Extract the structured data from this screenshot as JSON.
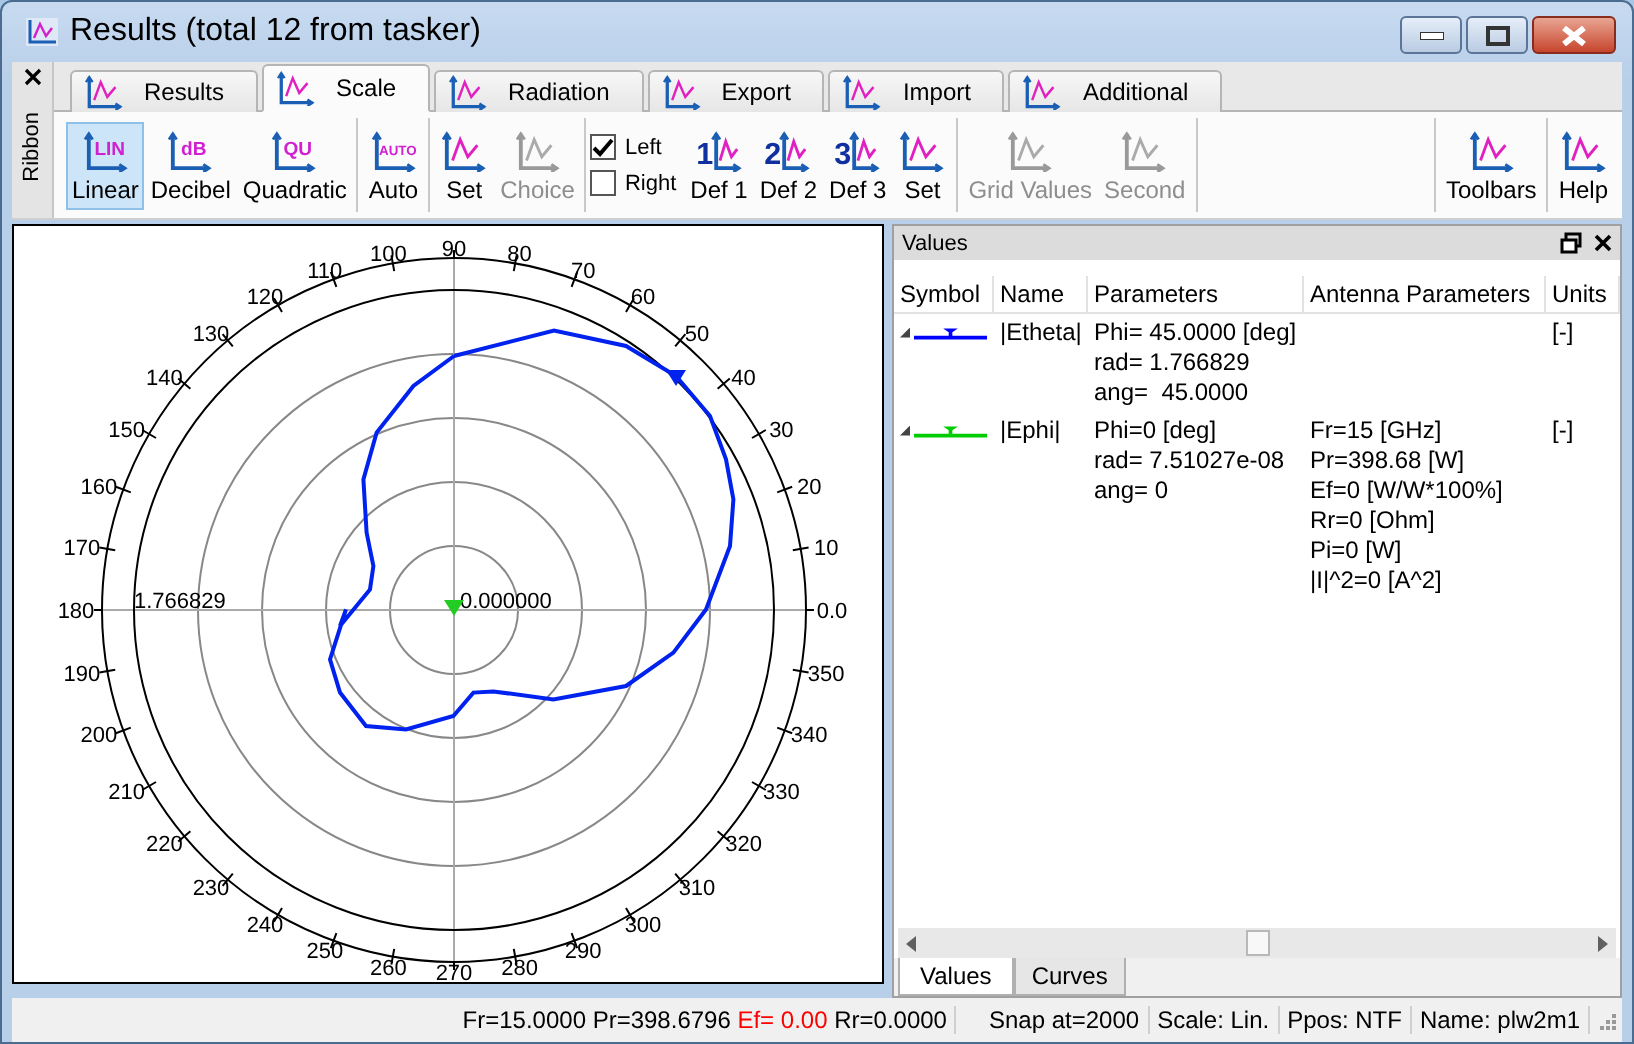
{
  "window": {
    "title": "Results (total 12 from tasker)"
  },
  "ribbon": {
    "label": "Ribbon"
  },
  "tabs": [
    {
      "label": "Results",
      "selected": false
    },
    {
      "label": "Scale",
      "selected": true
    },
    {
      "label": "Radiation",
      "selected": false
    },
    {
      "label": "Export",
      "selected": false
    },
    {
      "label": "Import",
      "selected": false
    },
    {
      "label": "Additional",
      "selected": false
    }
  ],
  "toolbar": {
    "groups": [
      [
        {
          "kind": "button",
          "label": "Linear",
          "badge": "LIN",
          "selected": true,
          "disabled": false
        },
        {
          "kind": "button",
          "label": "Decibel",
          "badge": "dB",
          "selected": false,
          "disabled": false
        },
        {
          "kind": "button",
          "label": "Quadratic",
          "badge": "QU",
          "selected": false,
          "disabled": false
        }
      ],
      [
        {
          "kind": "button",
          "label": "Auto",
          "badge": "AUTO",
          "selected": false,
          "disabled": false
        }
      ],
      [
        {
          "kind": "button",
          "label": "Set",
          "selected": false,
          "disabled": false
        },
        {
          "kind": "button",
          "label": "Choice",
          "selected": false,
          "disabled": true
        }
      ],
      [
        {
          "kind": "checkbox",
          "label": "Left",
          "checked": true
        },
        {
          "kind": "checkbox",
          "label": "Right",
          "checked": false
        },
        {
          "kind": "button",
          "label": "Def 1",
          "badge": "1",
          "selected": false,
          "disabled": false
        },
        {
          "kind": "button",
          "label": "Def 2",
          "badge": "2",
          "selected": false,
          "disabled": false
        },
        {
          "kind": "button",
          "label": "Def 3",
          "badge": "3",
          "selected": false,
          "disabled": false
        },
        {
          "kind": "button",
          "label": "Set",
          "selected": false,
          "disabled": false
        }
      ],
      [
        {
          "kind": "button",
          "label": "Grid Values",
          "selected": false,
          "disabled": true
        },
        {
          "kind": "button",
          "label": "Second",
          "selected": false,
          "disabled": true
        }
      ]
    ],
    "right_groups": [
      [
        {
          "kind": "button",
          "label": "Toolbars",
          "selected": false,
          "disabled": false
        }
      ],
      [
        {
          "kind": "button",
          "label": "Help",
          "selected": false,
          "disabled": false
        }
      ]
    ]
  },
  "polar_plot": {
    "left_angle_labels": [
      "100",
      "110",
      "120",
      "130",
      "140",
      "150",
      "160",
      "170",
      "180",
      "190",
      "200",
      "210",
      "220",
      "230",
      "240",
      "250",
      "260"
    ],
    "right_angle_labels": [
      "90",
      "80",
      "70",
      "60",
      "50",
      "40",
      "30",
      "20",
      "10",
      "0.0",
      "350",
      "340",
      "330",
      "320",
      "310",
      "300",
      "290",
      "280",
      "270"
    ],
    "radius_label": "1.766829",
    "center_label": "0.000000"
  },
  "values_panel": {
    "title": "Values",
    "columns": [
      "Symbol",
      "Name",
      "Parameters",
      "Antenna Parameters",
      "Units"
    ],
    "rows": [
      {
        "expanded": true,
        "color": "#0000ff",
        "name": "|Etheta|",
        "parameters": [
          "Phi= 45.0000 [deg]",
          "rad= 1.766829",
          "ang=  45.0000"
        ],
        "units": "[-]"
      },
      {
        "expanded": true,
        "color": "#00cc00",
        "name": "|Ephi|",
        "parameters": [
          "Phi=0 [deg]",
          "rad= 7.51027e-08",
          "ang= 0"
        ],
        "antenna_parameters": [
          "Fr=15 [GHz]",
          "Pr=398.68 [W]",
          "Ef=0 [W/W*100%]",
          "Rr=0 [Ohm]",
          "Pi=0 [W]",
          "|I|^2=0 [A^2]"
        ],
        "units": "[-]"
      }
    ],
    "tabs": [
      {
        "label": "Values",
        "selected": true
      },
      {
        "label": "Curves",
        "selected": false
      }
    ]
  },
  "status_bar": [
    {
      "parts": [
        {
          "text": "Fr=15.0000 Pr=398.6796 ",
          "alert": false
        },
        {
          "text": "Ef= 0.00",
          "alert": true
        },
        {
          "text": " Rr=0.0000",
          "alert": false
        }
      ]
    },
    {
      "parts": [
        {
          "text": "Snap at=2000",
          "alert": false
        }
      ]
    },
    {
      "parts": [
        {
          "text": "Scale: Lin.",
          "alert": false
        }
      ]
    },
    {
      "parts": [
        {
          "text": "Ppos: NTF",
          "alert": false
        }
      ]
    },
    {
      "parts": [
        {
          "text": "Name: plw2m1",
          "alert": false
        }
      ]
    }
  ]
}
